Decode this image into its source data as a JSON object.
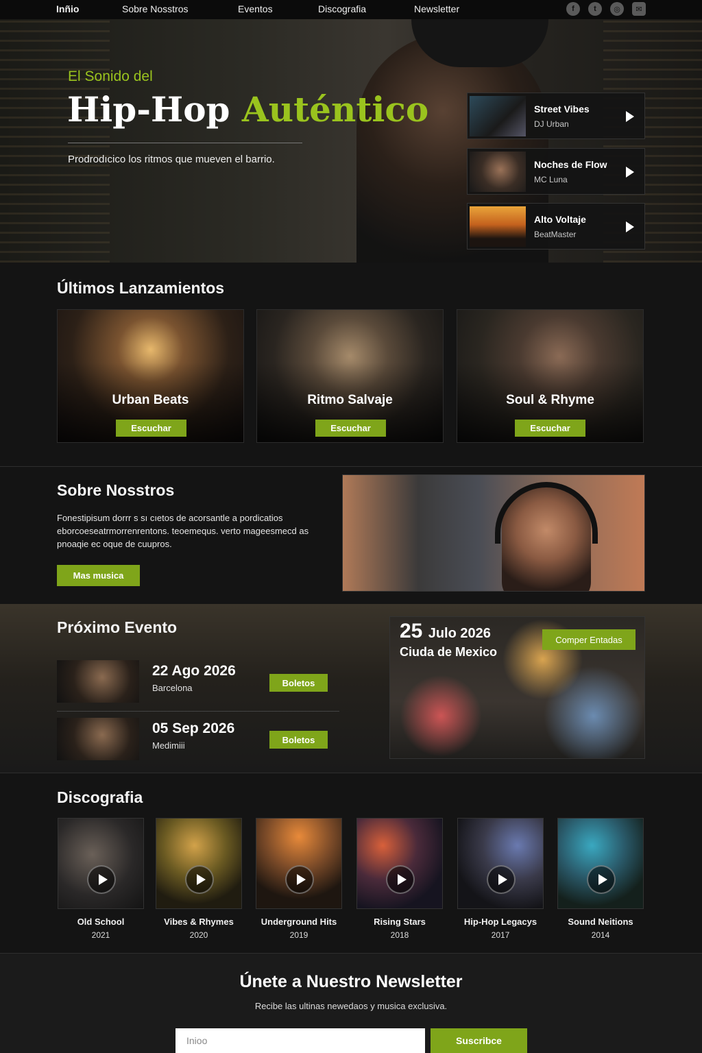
{
  "nav": {
    "items": [
      "Inñio",
      "Sobre Nosstros",
      "Eventos",
      "Discografia",
      "Newsletter"
    ],
    "socials": [
      {
        "name": "facebook-icon",
        "glyph": "f"
      },
      {
        "name": "twitter-icon",
        "glyph": "t"
      },
      {
        "name": "instagram-icon",
        "glyph": "◎"
      },
      {
        "name": "mail-icon",
        "glyph": "✉"
      }
    ]
  },
  "hero": {
    "subtitle": "El Sonido del",
    "title_main": "Hip-Hop",
    "title_accent": "Auténtico",
    "tagline": "Prodrodıcico los ritmos que mueven el barrio.",
    "tracks": [
      {
        "title": "Street Vibes",
        "artist": "DJ Urban"
      },
      {
        "title": "Noches de Flow",
        "artist": "MC Luna"
      },
      {
        "title": "Alto Voltaje",
        "artist": "BeatMaster"
      }
    ]
  },
  "releases": {
    "heading": "Últimos Lanzamientos",
    "items": [
      {
        "title": "Urban Beats",
        "button": "Escuchar"
      },
      {
        "title": "Ritmo Salvaje",
        "button": "Escuchar"
      },
      {
        "title": "Soul & Rhyme",
        "button": "Escuchar"
      }
    ]
  },
  "about": {
    "heading": "Sobre Nosstros",
    "paragraph": "Fonestipisum dorrr s sı cıetos de acorsantle a pordicatios eborcoeseatrmorrenrentons. teoemequs. verto mageesmecd as pnoaqie ec oque de cuupros.",
    "button": "Mas musica"
  },
  "events": {
    "heading": "Próximo Evento",
    "list": [
      {
        "date": "22 Ago 2026",
        "city": "Barcelona",
        "button": "Boletos"
      },
      {
        "date": "05 Sep 2026",
        "city": "Medimiii",
        "button": "Boletos"
      }
    ],
    "featured": {
      "day": "25",
      "month_year": "Julo 2026",
      "city": "Ciuda de Mexico",
      "button": "Comper Entadas"
    }
  },
  "discography": {
    "heading": "Discografia",
    "albums": [
      {
        "title": "Old School",
        "year": "2021"
      },
      {
        "title": "Vibes & Rhymes",
        "year": "2020"
      },
      {
        "title": "Underground Hits",
        "year": "2019"
      },
      {
        "title": "Rising Stars",
        "year": "2018"
      },
      {
        "title": "Hip-Hop Legacys",
        "year": "2017"
      },
      {
        "title": "Sound Neitions",
        "year": "2014"
      }
    ]
  },
  "newsletter": {
    "heading": "Únete a Nuestro Newsletter",
    "subtitle": "Recibe las ultinas newedaos y musica exclusiva.",
    "placeholder": "Inioo",
    "button": "Suscribce"
  },
  "colors": {
    "accent": "#9ac31e",
    "button": "#7fa51a",
    "background": "#141414"
  }
}
